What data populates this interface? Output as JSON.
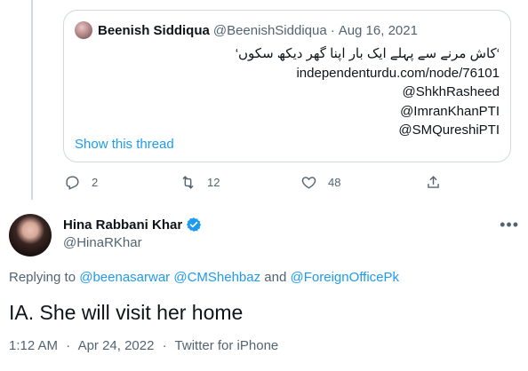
{
  "quoted_tweet": {
    "author_name": "Beenish Siddiqua",
    "author_handle": "@BeenishSiddiqua",
    "separator": "·",
    "date": "Aug 16, 2021",
    "lines": [
      "‘کاش مرنے سے پہلے ایک بار اپنا گھر دیکھ سکوں‘",
      "independenturdu.com/node/76101",
      "@ShkhRasheed",
      "@ImranKhanPTI",
      "@SMQureshiPTI"
    ],
    "show_thread": "Show this thread"
  },
  "actions": {
    "reply_count": "2",
    "retweet_count": "12",
    "like_count": "48"
  },
  "tweet": {
    "author_name": "Hina Rabbani Khar",
    "author_handle": "@HinaRKhar",
    "more": "•••",
    "replying_to_label": "Replying to",
    "mention_1": "@beenasarwar",
    "mention_2": "@CMShehbaz",
    "and_label": "and",
    "mention_3": "@ForeignOfficePk",
    "text": "IA. She will visit her home",
    "time": "1:12 AM",
    "separator": "·",
    "date": "Apr 24, 2022",
    "source": "Twitter for iPhone"
  },
  "colors": {
    "link": "#1d9bf0",
    "secondary_text": "#536471",
    "border": "#cfd9de"
  },
  "icons": [
    "reply-icon",
    "retweet-icon",
    "like-icon",
    "share-icon",
    "verified-badge-icon",
    "more-icon"
  ]
}
